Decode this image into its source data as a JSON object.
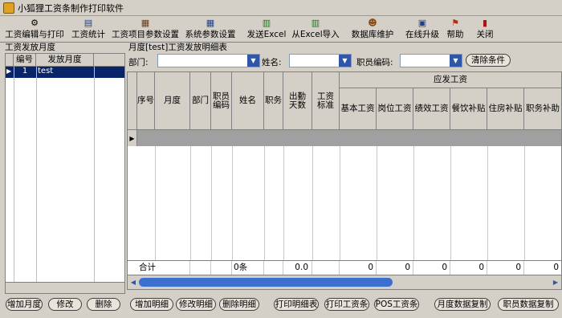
{
  "app": {
    "title": "小狐狸工资条制作打印软件"
  },
  "toolbar": {
    "items": [
      {
        "label": "工资编辑与打印",
        "icon": "gear-icon"
      },
      {
        "label": "工资统计",
        "icon": "book-icon"
      },
      {
        "label": "工资项目参数设置",
        "icon": "calculator-icon"
      },
      {
        "label": "系统参数设置",
        "icon": "grid-icon"
      },
      {
        "label": "发送Excel",
        "icon": "excel-export-icon"
      },
      {
        "label": "从Excel导入",
        "icon": "excel-import-icon"
      },
      {
        "label": "数据库维护",
        "icon": "person-icon"
      },
      {
        "label": "在线升级",
        "icon": "upgrade-icon"
      },
      {
        "label": "帮助",
        "icon": "help-icon"
      },
      {
        "label": "关闭",
        "icon": "close-door-icon"
      }
    ]
  },
  "left": {
    "title": "工资发放月度",
    "headers": [
      "编号",
      "发放月度"
    ],
    "rows": [
      {
        "id": "1",
        "month": "test"
      }
    ]
  },
  "right": {
    "title": "月度[test]工资发放明细表",
    "filters": {
      "department_label": "部门:",
      "name_label": "姓名:",
      "empno_label": "职员编码:",
      "clear_button": "清除条件"
    },
    "headers": {
      "seq": "序号",
      "month": "月度",
      "dept": "部门",
      "empno": "职员编码",
      "name": "姓名",
      "position": "职务",
      "attendance": "出勤天数",
      "standard": "工资标准",
      "group": "应发工资",
      "sub": [
        "基本工资",
        "岗位工资",
        "绩效工资",
        "餐饮补贴",
        "住房补贴",
        "职务补助"
      ]
    },
    "totals": {
      "label": "合计",
      "count": "0条",
      "attendance": "0.0",
      "values": [
        "0",
        "0",
        "0",
        "0",
        "0",
        "0"
      ]
    }
  },
  "buttons": {
    "left": [
      "增加月度",
      "修改",
      "删除"
    ],
    "right": [
      "增加明细",
      "修改明细",
      "删除明细",
      "打印明细表",
      "打印工资条",
      "POS工资条",
      "月度数据复制",
      "职员数据复制"
    ]
  }
}
